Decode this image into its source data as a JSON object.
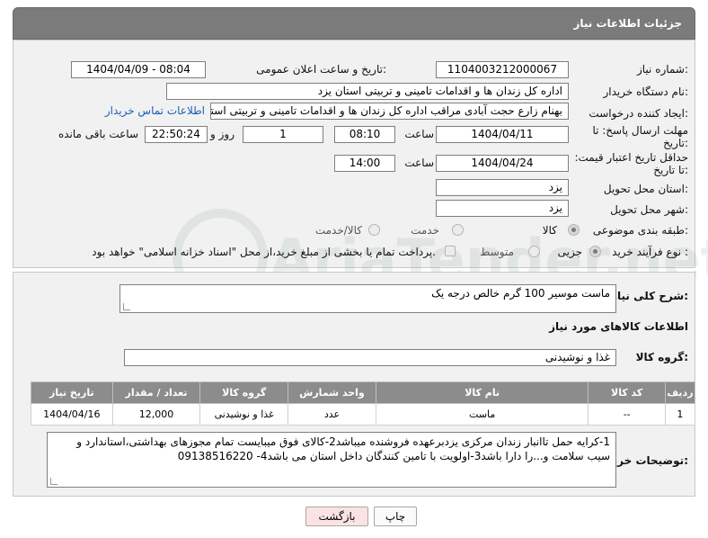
{
  "header": {
    "title": "جزئیات اطلاعات نیاز"
  },
  "labels": {
    "need_number": "شماره نیاز:",
    "announce_datetime": "تاریخ و ساعت اعلان عمومی:",
    "buyer_org": "نام دستگاه خریدار:",
    "requester": "ایجاد کننده درخواست:",
    "reply_deadline": "مهلت ارسال پاسخ: تا تاریخ:",
    "price_validity": "حداقل تاریخ اعتبار قیمت: تا تاریخ:",
    "time": "ساعت",
    "day_and": "روز و",
    "remaining": "ساعت باقی مانده",
    "delivery_province": "استان محل تحویل:",
    "delivery_city": "شهر محل تحویل:",
    "category": "طبقه بندی موضوعی:",
    "purchase_type": "نوع فرآیند خرید :",
    "general_desc": "شرح کلی نیاز:",
    "goods_info": "اطلاعات کالاهای مورد نیاز",
    "goods_group": "گروه کالا:",
    "buyer_notes": "توضیحات خریدار:"
  },
  "fields": {
    "need_number": "1104003212000067",
    "announce_datetime": "1404/04/09 - 08:04",
    "buyer_org": "اداره کل زندان ها و اقدامات تامینی و تربیتی استان یزد",
    "requester": "بهنام زارع حجت آبادی مراقب اداره کل زندان ها و اقدامات تامینی و تربیتی استان",
    "contact_link": "اطلاعات تماس خریدار",
    "reply_date": "1404/04/11",
    "reply_time": "08:10",
    "reply_days": "1",
    "reply_remaining": "22:50:24",
    "price_date": "1404/04/24",
    "price_time": "14:00",
    "province": "یزد",
    "city": "یزد",
    "general_desc": "ماست موسیر 100 گرم خالص درجه یک",
    "goods_group": "غذا و نوشیدنی",
    "buyer_notes": "1-کرایه حمل تاانبار زندان مرکزی یزدبرعهده فروشنده میباشد2-کالای فوق میبایست تمام مجوزهای بهداشتی،استاندارد و سیب سلامت و...را دارا باشد3-اولویت با تامین کنندگان داخل استان می باشد4- 09138516220"
  },
  "category_options": [
    "کالا",
    "خدمت",
    "کالا/خدمت"
  ],
  "purchase_options": {
    "minor": "جزیی",
    "medium": "متوسط",
    "treasury_note": "پرداخت تمام یا بخشی از مبلغ خرید،از محل \"اسناد خزانه اسلامی\" خواهد بود."
  },
  "table": {
    "headers": [
      "ردیف",
      "کد کالا",
      "نام کالا",
      "واحد شمارش",
      "گروه کالا",
      "تعداد / مقدار",
      "تاریخ نیاز"
    ],
    "rows": [
      [
        "1",
        "--",
        "ماست",
        "عدد",
        "غذا و نوشیدنی",
        "12,000",
        "1404/04/16"
      ]
    ]
  },
  "buttons": {
    "print": "چاپ",
    "back": "بازگشت"
  },
  "watermark": {
    "text": "AriaTender.net"
  },
  "colors": {
    "header_bg": "#7b7b7b",
    "panel_bg": "#f1f1f1",
    "link": "#1a5fb4",
    "back_btn_bg": "#fbe3e3"
  }
}
